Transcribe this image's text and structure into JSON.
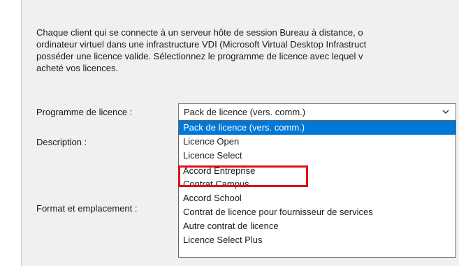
{
  "intro": {
    "lines": [
      "Chaque client qui se connecte à un serveur hôte de session Bureau à distance, o",
      "ordinateur virtuel dans une infrastructure VDI (Microsoft Virtual Desktop Infrastruct",
      "posséder une licence valide. Sélectionnez le programme de licence avec lequel v",
      "acheté vos licences."
    ]
  },
  "form": {
    "program_label": "Programme de licence :",
    "description_label": "Description :",
    "format_label": "Format et emplacement :"
  },
  "combo": {
    "selected_value": "Pack de licence (vers. comm.)",
    "arrow_icon": "chevron-down-icon"
  },
  "dropdown": {
    "options": [
      "Pack de licence (vers. comm.)",
      "Licence Open",
      "Licence Select",
      "Accord Entreprise",
      "Contrat Campus",
      "Accord School",
      "Contrat de licence pour fournisseur de services",
      "Autre contrat de licence",
      "Licence Select Plus"
    ],
    "selected_index": 0,
    "highlighted_option": "Accord Entreprise"
  },
  "colors": {
    "selection": "#0078d7",
    "highlight_border": "#e0101a",
    "panel_background": "#f0f0f0"
  }
}
